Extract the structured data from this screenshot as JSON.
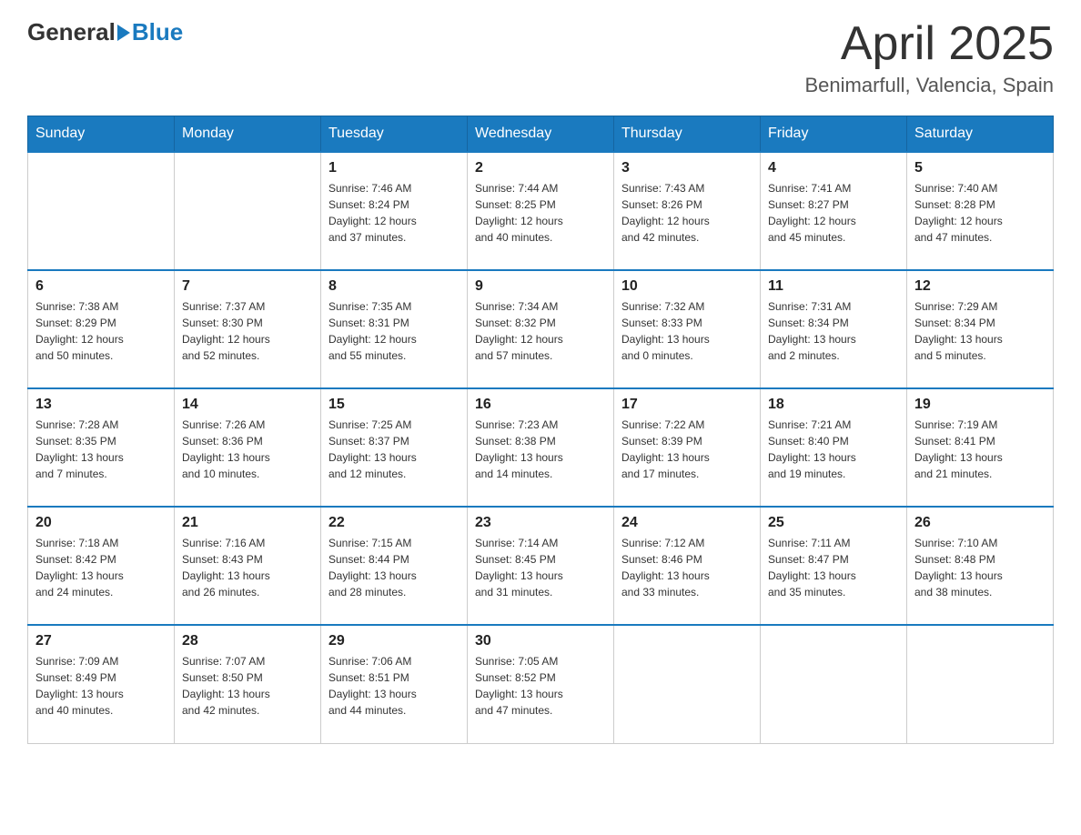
{
  "header": {
    "logo": {
      "part1": "General",
      "part2": "Blue"
    },
    "title": "April 2025",
    "subtitle": "Benimarfull, Valencia, Spain"
  },
  "calendar": {
    "days_of_week": [
      "Sunday",
      "Monday",
      "Tuesday",
      "Wednesday",
      "Thursday",
      "Friday",
      "Saturday"
    ],
    "weeks": [
      [
        {
          "day": "",
          "info": ""
        },
        {
          "day": "",
          "info": ""
        },
        {
          "day": "1",
          "info": "Sunrise: 7:46 AM\nSunset: 8:24 PM\nDaylight: 12 hours\nand 37 minutes."
        },
        {
          "day": "2",
          "info": "Sunrise: 7:44 AM\nSunset: 8:25 PM\nDaylight: 12 hours\nand 40 minutes."
        },
        {
          "day": "3",
          "info": "Sunrise: 7:43 AM\nSunset: 8:26 PM\nDaylight: 12 hours\nand 42 minutes."
        },
        {
          "day": "4",
          "info": "Sunrise: 7:41 AM\nSunset: 8:27 PM\nDaylight: 12 hours\nand 45 minutes."
        },
        {
          "day": "5",
          "info": "Sunrise: 7:40 AM\nSunset: 8:28 PM\nDaylight: 12 hours\nand 47 minutes."
        }
      ],
      [
        {
          "day": "6",
          "info": "Sunrise: 7:38 AM\nSunset: 8:29 PM\nDaylight: 12 hours\nand 50 minutes."
        },
        {
          "day": "7",
          "info": "Sunrise: 7:37 AM\nSunset: 8:30 PM\nDaylight: 12 hours\nand 52 minutes."
        },
        {
          "day": "8",
          "info": "Sunrise: 7:35 AM\nSunset: 8:31 PM\nDaylight: 12 hours\nand 55 minutes."
        },
        {
          "day": "9",
          "info": "Sunrise: 7:34 AM\nSunset: 8:32 PM\nDaylight: 12 hours\nand 57 minutes."
        },
        {
          "day": "10",
          "info": "Sunrise: 7:32 AM\nSunset: 8:33 PM\nDaylight: 13 hours\nand 0 minutes."
        },
        {
          "day": "11",
          "info": "Sunrise: 7:31 AM\nSunset: 8:34 PM\nDaylight: 13 hours\nand 2 minutes."
        },
        {
          "day": "12",
          "info": "Sunrise: 7:29 AM\nSunset: 8:34 PM\nDaylight: 13 hours\nand 5 minutes."
        }
      ],
      [
        {
          "day": "13",
          "info": "Sunrise: 7:28 AM\nSunset: 8:35 PM\nDaylight: 13 hours\nand 7 minutes."
        },
        {
          "day": "14",
          "info": "Sunrise: 7:26 AM\nSunset: 8:36 PM\nDaylight: 13 hours\nand 10 minutes."
        },
        {
          "day": "15",
          "info": "Sunrise: 7:25 AM\nSunset: 8:37 PM\nDaylight: 13 hours\nand 12 minutes."
        },
        {
          "day": "16",
          "info": "Sunrise: 7:23 AM\nSunset: 8:38 PM\nDaylight: 13 hours\nand 14 minutes."
        },
        {
          "day": "17",
          "info": "Sunrise: 7:22 AM\nSunset: 8:39 PM\nDaylight: 13 hours\nand 17 minutes."
        },
        {
          "day": "18",
          "info": "Sunrise: 7:21 AM\nSunset: 8:40 PM\nDaylight: 13 hours\nand 19 minutes."
        },
        {
          "day": "19",
          "info": "Sunrise: 7:19 AM\nSunset: 8:41 PM\nDaylight: 13 hours\nand 21 minutes."
        }
      ],
      [
        {
          "day": "20",
          "info": "Sunrise: 7:18 AM\nSunset: 8:42 PM\nDaylight: 13 hours\nand 24 minutes."
        },
        {
          "day": "21",
          "info": "Sunrise: 7:16 AM\nSunset: 8:43 PM\nDaylight: 13 hours\nand 26 minutes."
        },
        {
          "day": "22",
          "info": "Sunrise: 7:15 AM\nSunset: 8:44 PM\nDaylight: 13 hours\nand 28 minutes."
        },
        {
          "day": "23",
          "info": "Sunrise: 7:14 AM\nSunset: 8:45 PM\nDaylight: 13 hours\nand 31 minutes."
        },
        {
          "day": "24",
          "info": "Sunrise: 7:12 AM\nSunset: 8:46 PM\nDaylight: 13 hours\nand 33 minutes."
        },
        {
          "day": "25",
          "info": "Sunrise: 7:11 AM\nSunset: 8:47 PM\nDaylight: 13 hours\nand 35 minutes."
        },
        {
          "day": "26",
          "info": "Sunrise: 7:10 AM\nSunset: 8:48 PM\nDaylight: 13 hours\nand 38 minutes."
        }
      ],
      [
        {
          "day": "27",
          "info": "Sunrise: 7:09 AM\nSunset: 8:49 PM\nDaylight: 13 hours\nand 40 minutes."
        },
        {
          "day": "28",
          "info": "Sunrise: 7:07 AM\nSunset: 8:50 PM\nDaylight: 13 hours\nand 42 minutes."
        },
        {
          "day": "29",
          "info": "Sunrise: 7:06 AM\nSunset: 8:51 PM\nDaylight: 13 hours\nand 44 minutes."
        },
        {
          "day": "30",
          "info": "Sunrise: 7:05 AM\nSunset: 8:52 PM\nDaylight: 13 hours\nand 47 minutes."
        },
        {
          "day": "",
          "info": ""
        },
        {
          "day": "",
          "info": ""
        },
        {
          "day": "",
          "info": ""
        }
      ]
    ]
  }
}
